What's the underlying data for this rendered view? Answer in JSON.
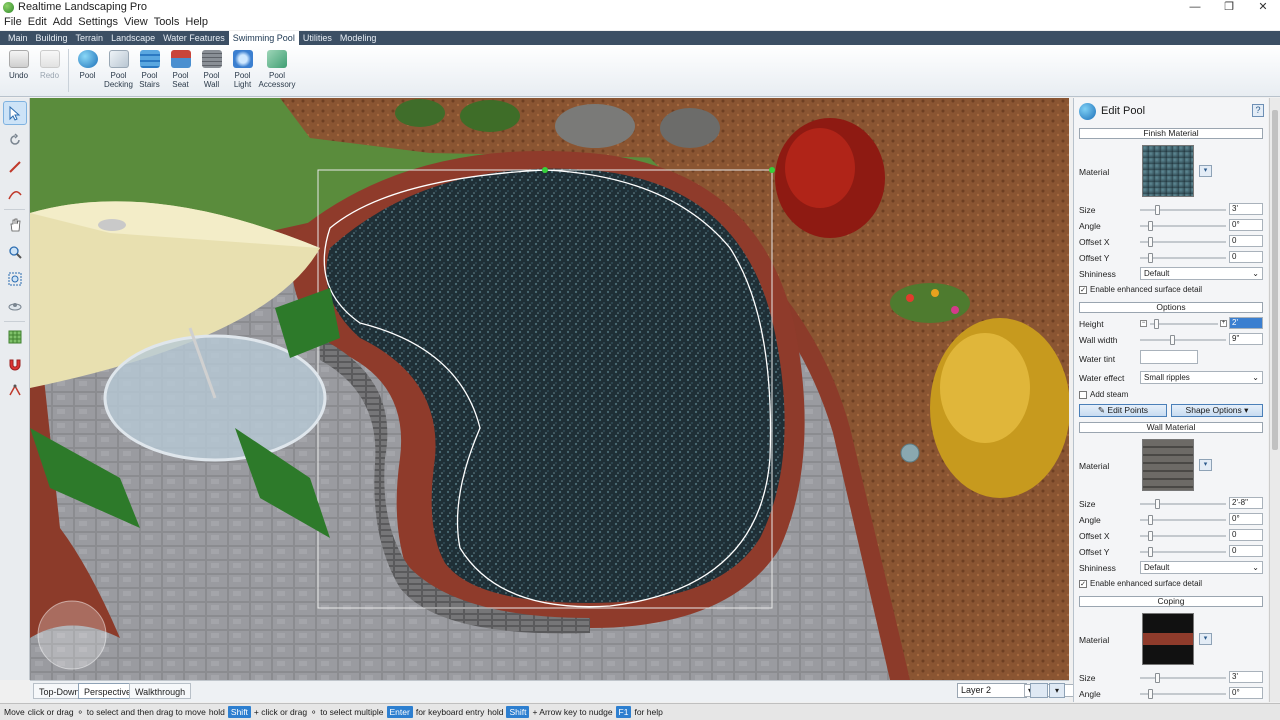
{
  "window": {
    "title": "Realtime Landscaping Pro"
  },
  "menu": [
    "File",
    "Edit",
    "Add",
    "Settings",
    "View",
    "Tools",
    "Help"
  ],
  "tabs": [
    "Main",
    "Building",
    "Terrain",
    "Landscape",
    "Water Features",
    "Swimming Pool",
    "Utilities",
    "Modeling"
  ],
  "active_tab": "Swimming Pool",
  "ribbon": {
    "undo": "Undo",
    "redo": "Redo",
    "buttons": [
      {
        "line1": "Pool",
        "line2": ""
      },
      {
        "line1": "Pool",
        "line2": "Decking"
      },
      {
        "line1": "Pool",
        "line2": "Stairs"
      },
      {
        "line1": "Pool",
        "line2": "Seat"
      },
      {
        "line1": "Pool",
        "line2": "Wall"
      },
      {
        "line1": "Pool",
        "line2": "Light"
      },
      {
        "line1": "Pool",
        "line2": "Accessory"
      }
    ]
  },
  "view_tabs": [
    "Top-Down",
    "Perspective",
    "Walkthrough"
  ],
  "active_view": "Perspective",
  "layer": "Layer 2",
  "status": {
    "t1": "Move",
    "t2": "click or drag",
    "t3": "to select and then drag to move",
    "t4": "hold",
    "k1": "Shift",
    "t5": "+ click or drag",
    "t6": "to select multiple",
    "k2": "Enter",
    "t7": "for keyboard entry",
    "t8": "hold",
    "k3": "Shift",
    "t9": "+ Arrow key to nudge",
    "k4": "F1",
    "t10": "for help"
  },
  "panel": {
    "title": "Edit Pool",
    "help": "?",
    "finish": {
      "section": "Finish Material",
      "material_label": "Material",
      "size_label": "Size",
      "size_value": "3'",
      "angle_label": "Angle",
      "angle_value": "0°",
      "offx_label": "Offset X",
      "offx_value": "0",
      "offy_label": "Offset Y",
      "offy_value": "0",
      "shine_label": "Shininess",
      "shine_value": "Default",
      "enhanced": "Enable enhanced surface detail"
    },
    "options": {
      "section": "Options",
      "height_label": "Height",
      "height_value": "2'",
      "wall_label": "Wall width",
      "wall_value": "9\"",
      "tint_label": "Water tint",
      "effect_label": "Water effect",
      "effect_value": "Small ripples",
      "steam": "Add steam",
      "edit_points": "Edit Points",
      "shape_options": "Shape Options"
    },
    "wall": {
      "section": "Wall Material",
      "material_label": "Material",
      "size_label": "Size",
      "size_value": "2'-8\"",
      "angle_label": "Angle",
      "angle_value": "0°",
      "offx_label": "Offset X",
      "offx_value": "0",
      "offy_label": "Offset Y",
      "offy_value": "0",
      "shine_label": "Shininess",
      "shine_value": "Default",
      "enhanced": "Enable enhanced surface detail"
    },
    "coping": {
      "section": "Coping",
      "material_label": "Material",
      "size_label": "Size",
      "size_value": "3'",
      "angle_label": "Angle",
      "angle_value": "0°"
    }
  }
}
